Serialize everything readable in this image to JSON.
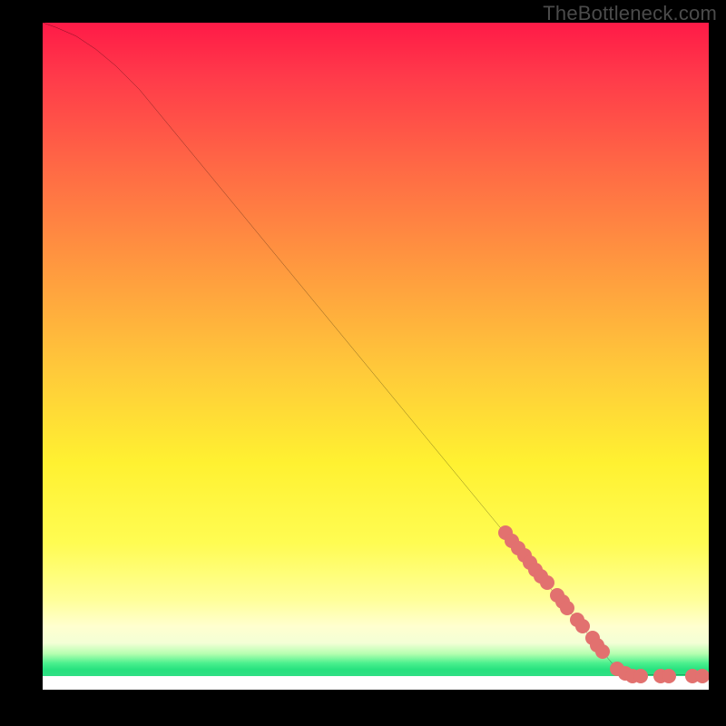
{
  "watermark": "TheBottleneck.com",
  "chart_data": {
    "type": "line",
    "title": "",
    "xlabel": "",
    "ylabel": "",
    "xlim": [
      0,
      100
    ],
    "ylim": [
      0,
      100
    ],
    "curve": [
      {
        "x": 0.0,
        "y": 100.0
      },
      {
        "x": 2.0,
        "y": 99.3
      },
      {
        "x": 5.0,
        "y": 98.0
      },
      {
        "x": 8.0,
        "y": 96.0
      },
      {
        "x": 11.0,
        "y": 93.5
      },
      {
        "x": 14.5,
        "y": 90.0
      },
      {
        "x": 86.0,
        "y": 3.2
      },
      {
        "x": 87.0,
        "y": 2.6
      },
      {
        "x": 88.0,
        "y": 2.3
      },
      {
        "x": 90.0,
        "y": 2.1
      },
      {
        "x": 100.0,
        "y": 2.1
      }
    ],
    "markers": [
      {
        "x": 69.5,
        "y": 23.5
      },
      {
        "x": 70.5,
        "y": 22.3
      },
      {
        "x": 71.4,
        "y": 21.2
      },
      {
        "x": 72.3,
        "y": 20.1
      },
      {
        "x": 73.1,
        "y": 19.1
      },
      {
        "x": 74.0,
        "y": 18.0
      },
      {
        "x": 74.8,
        "y": 17.0
      },
      {
        "x": 75.7,
        "y": 16.0
      },
      {
        "x": 77.2,
        "y": 14.2
      },
      {
        "x": 78.0,
        "y": 13.2
      },
      {
        "x": 78.8,
        "y": 12.2
      },
      {
        "x": 80.2,
        "y": 10.5
      },
      {
        "x": 81.0,
        "y": 9.5
      },
      {
        "x": 82.5,
        "y": 7.7
      },
      {
        "x": 83.3,
        "y": 6.7
      },
      {
        "x": 84.1,
        "y": 5.7
      },
      {
        "x": 86.2,
        "y": 3.1
      },
      {
        "x": 87.5,
        "y": 2.4
      },
      {
        "x": 88.6,
        "y": 2.1
      },
      {
        "x": 89.8,
        "y": 2.1
      },
      {
        "x": 92.8,
        "y": 2.1
      },
      {
        "x": 94.0,
        "y": 2.1
      },
      {
        "x": 97.6,
        "y": 2.1
      },
      {
        "x": 99.0,
        "y": 2.1
      }
    ],
    "background": {
      "type": "vertical-gradient",
      "stops": [
        {
          "pos": 0.0,
          "color": "#ff1a47"
        },
        {
          "pos": 0.52,
          "color": "#ffc93a"
        },
        {
          "pos": 0.78,
          "color": "#fffc52"
        },
        {
          "pos": 0.905,
          "color": "#ffffcf"
        },
        {
          "pos": 0.96,
          "color": "#4cf08e"
        },
        {
          "pos": 0.979,
          "color": "#2fe084"
        },
        {
          "pos": 0.98,
          "color": "#ffffff"
        },
        {
          "pos": 1.0,
          "color": "#ffffff"
        }
      ]
    }
  }
}
